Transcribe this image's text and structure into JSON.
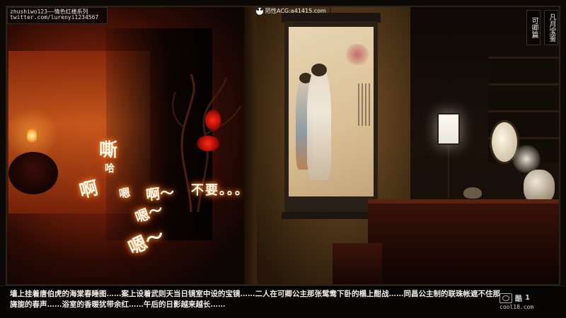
{
  "watermark": {
    "line1": "zhushiwo123——情色红楼系列",
    "line2": "twitter.com/lurenyi1234567"
  },
  "top_site": {
    "icon": "panda-icon",
    "text": "陌性ACG:a41415.com"
  },
  "menu": {
    "button1": "可卿篇",
    "button2": "凡月宝鉴"
  },
  "sfx": {
    "s1": "嘶",
    "s2": "哈",
    "s3": "啊",
    "s4": "嗯",
    "s5": "啊～",
    "s6": "不要。。。",
    "s7": "嗯～",
    "s8": "嗯～"
  },
  "dialogue": {
    "text": "墙上挂着唐伯虎的海棠春睡图……案上设着武则天当日镜室中设的宝镜……二人在可卿公主那张鸳鸯下卧的榻上酣战……同昌公主制的联珠帐遮不住那旖旎的春声……浴室的香暖犹带余红……午后的日影越来越长……"
  },
  "logo": {
    "glyph": "酷",
    "number": "1",
    "site": "cool18.com"
  },
  "colors": {
    "glow_orange": "#ff9a3c",
    "glow_red": "#ff5a10",
    "panel_bg": "#050403"
  }
}
